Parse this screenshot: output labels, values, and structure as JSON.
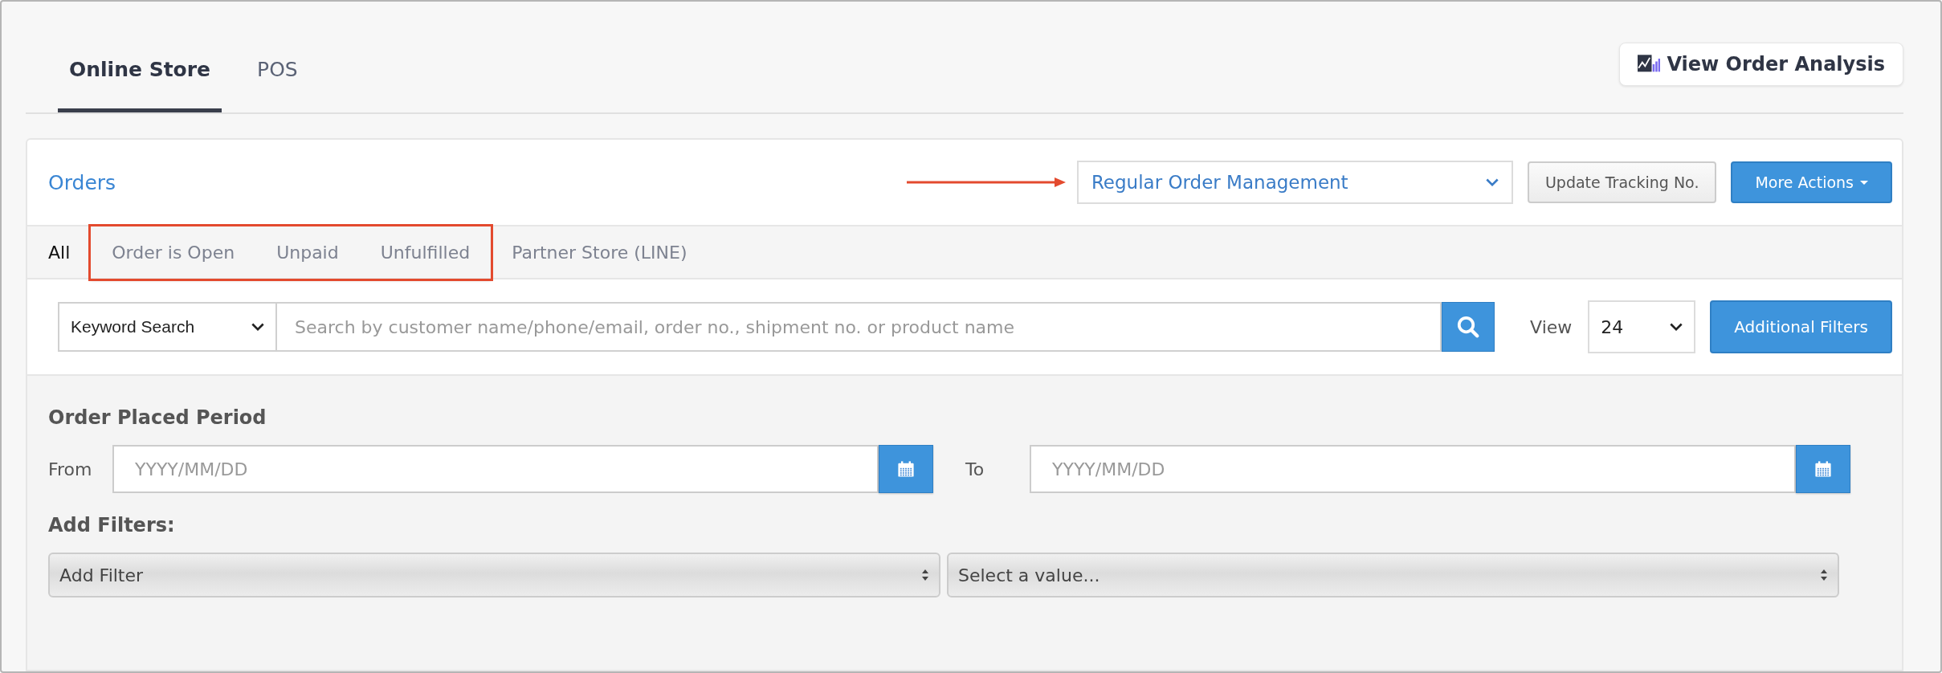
{
  "tabs": [
    {
      "label": "Online Store",
      "selected": true
    },
    {
      "label": "POS",
      "selected": false
    }
  ],
  "analysis_button": {
    "label": "View Order Analysis"
  },
  "orders": {
    "title": "Orders",
    "mode_select": {
      "value": "Regular Order Management"
    },
    "update_button": "Update Tracking No.",
    "actions_button": "More Actions"
  },
  "status_tabs": [
    {
      "label": "All",
      "selected": true,
      "highlighted": false
    },
    {
      "label": "Order is Open",
      "selected": false,
      "highlighted": true
    },
    {
      "label": "Unpaid",
      "selected": false,
      "highlighted": true
    },
    {
      "label": "Unfulfilled",
      "selected": false,
      "highlighted": true
    },
    {
      "label": "Partner Store (LINE)",
      "selected": false,
      "highlighted": false
    }
  ],
  "search": {
    "type_select": "Keyword Search",
    "placeholder": "Search by customer name/phone/email, order no., shipment no. or product name",
    "view_label": "View",
    "view_select": "24",
    "filters_button": "Additional Filters"
  },
  "period": {
    "title": "Order Placed Period",
    "from_label": "From",
    "from_placeholder": "YYYY/MM/DD",
    "to_label": "To",
    "to_placeholder": "YYYY/MM/DD"
  },
  "add_filters": {
    "title": "Add Filters:",
    "filter_select": "Add Filter",
    "value_select": "Select a value..."
  }
}
